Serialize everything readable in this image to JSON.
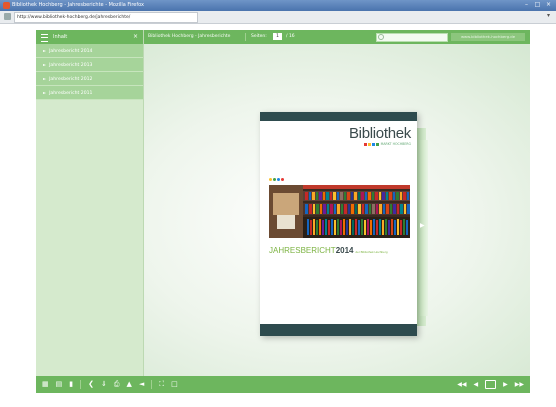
{
  "window": {
    "title": "Bibliothek Hochberg - Jahresberichte - Mozilla Firefox",
    "buttons": [
      "–",
      "□",
      "×"
    ]
  },
  "address_bar": {
    "url": "http://www.bibliothek-hochberg.de/jahresberichte/"
  },
  "sidebar": {
    "header": "Inhalt",
    "items": [
      {
        "label": "Jahresbericht 2014"
      },
      {
        "label": "Jahresbericht 2013"
      },
      {
        "label": "Jahresbericht 2012"
      },
      {
        "label": "Jahresbericht 2011"
      }
    ]
  },
  "top_toolbar": {
    "breadcrumb": "Bibliothek Hochberg - Jahresberichte",
    "page_label": "Seiten:",
    "page_current": "1",
    "page_total": "/ 16",
    "search_placeholder": "",
    "brand_link": "www.bibliothek-hochberg.de"
  },
  "document": {
    "logo_name": "Bibliothek",
    "logo_sub": "MARKT HOCHBERG",
    "title_prefix": "JAHRESBERICHT",
    "title_year": "2014",
    "title_suffix": "der Bibliothek Hochberg"
  },
  "colors": {
    "accent": "#6db65e",
    "sidebar_item": "#a6d49a",
    "cover_band": "#2e4b4e",
    "cover_title": "#7cb342"
  },
  "bottom_toolbar": {
    "left_icons": [
      "thumbnails-icon",
      "pages-icon",
      "bookmark-icon",
      "share-icon",
      "download-icon",
      "print-icon",
      "zoom-in-icon",
      "zoom-out-icon",
      "fullscreen-icon",
      "sound-icon"
    ],
    "right_icons": [
      "first-page-icon",
      "prev-page-icon",
      "double-page-icon",
      "next-page-icon",
      "last-page-icon"
    ]
  }
}
